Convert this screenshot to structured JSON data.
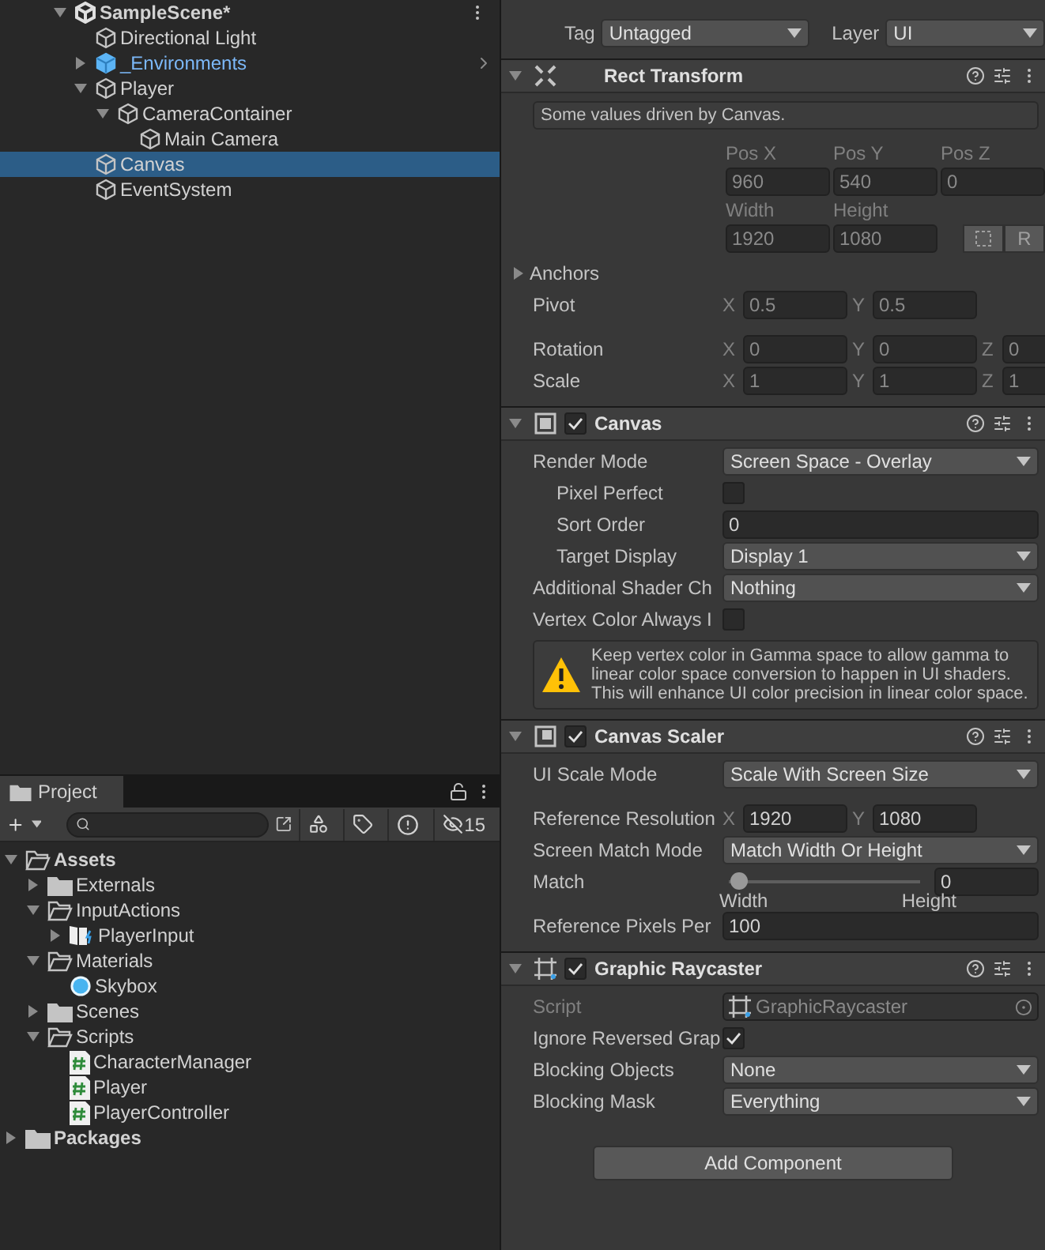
{
  "hierarchy": {
    "scene": "SampleScene*",
    "items": [
      {
        "name": "Directional Light",
        "kind": "object",
        "selected": false
      },
      {
        "name": "_Environments",
        "kind": "prefab",
        "expanded": false,
        "selected": false
      },
      {
        "name": "Player",
        "kind": "object",
        "expanded": true,
        "selected": false,
        "children": [
          {
            "name": "CameraContainer",
            "kind": "object",
            "expanded": true,
            "selected": false,
            "children": [
              {
                "name": "Main Camera",
                "kind": "object",
                "selected": false
              }
            ]
          }
        ]
      },
      {
        "name": "Canvas",
        "kind": "object",
        "selected": true
      },
      {
        "name": "EventSystem",
        "kind": "object",
        "selected": false
      }
    ]
  },
  "project": {
    "tab": "Project",
    "hidden_count": "15",
    "items": [
      {
        "name": "Assets",
        "kind": "folder",
        "expanded": true,
        "children": [
          {
            "name": "Externals",
            "kind": "folder",
            "expanded": false
          },
          {
            "name": "InputActions",
            "kind": "folder",
            "expanded": true,
            "children": [
              {
                "name": "PlayerInput",
                "kind": "input",
                "expanded": false
              }
            ]
          },
          {
            "name": "Materials",
            "kind": "folder",
            "expanded": true,
            "children": [
              {
                "name": "Skybox",
                "kind": "material"
              }
            ]
          },
          {
            "name": "Scenes",
            "kind": "folder",
            "expanded": false
          },
          {
            "name": "Scripts",
            "kind": "folder",
            "expanded": true,
            "children": [
              {
                "name": "CharacterManager",
                "kind": "script"
              },
              {
                "name": "Player",
                "kind": "script"
              },
              {
                "name": "PlayerController",
                "kind": "script"
              }
            ]
          }
        ]
      },
      {
        "name": "Packages",
        "kind": "folder",
        "expanded": false
      }
    ]
  },
  "inspector": {
    "tag_label": "Tag",
    "tag": "Untagged",
    "layer_label": "Layer",
    "layer": "UI",
    "components": [
      {
        "kind": "rect_transform",
        "title": "Rect Transform",
        "expanded": true,
        "note": "Some values driven by Canvas.",
        "position": [
          {
            "label": "Pos X",
            "value": "960"
          },
          {
            "label": "Pos Y",
            "value": "540"
          },
          {
            "label": "Pos Z",
            "value": "0"
          }
        ],
        "size": [
          {
            "label": "Width",
            "value": "1920"
          },
          {
            "label": "Height",
            "value": "1080"
          }
        ],
        "raw_button": "R",
        "anchors": "Anchors",
        "pivot": {
          "label": "Pivot",
          "axes": [
            {
              "axis": "X",
              "value": "0.5"
            },
            {
              "axis": "Y",
              "value": "0.5"
            }
          ]
        },
        "rotation": {
          "label": "Rotation",
          "axes": [
            {
              "axis": "X",
              "value": "0"
            },
            {
              "axis": "Y",
              "value": "0"
            },
            {
              "axis": "Z",
              "value": "0"
            }
          ]
        },
        "scale": {
          "label": "Scale",
          "axes": [
            {
              "axis": "X",
              "value": "1"
            },
            {
              "axis": "Y",
              "value": "1"
            },
            {
              "axis": "Z",
              "value": "1"
            }
          ]
        }
      },
      {
        "kind": "canvas",
        "title": "Canvas",
        "expanded": true,
        "enabled": true,
        "rows": [
          {
            "kind": "dropdown",
            "label": "Render Mode",
            "value": "Screen Space - Overlay",
            "children": [
              {
                "kind": "checkbox",
                "label": "Pixel Perfect",
                "checked": false
              },
              {
                "kind": "field",
                "label": "Sort Order",
                "value": "0"
              },
              {
                "kind": "dropdown",
                "label": "Target Display",
                "value": "Display 1"
              }
            ]
          },
          {
            "kind": "dropdown",
            "label": "Additional Shader Ch",
            "value": "Nothing"
          },
          {
            "kind": "checkbox",
            "label": "Vertex Color Always I",
            "checked": false
          },
          {
            "kind": "warning",
            "text": "Keep vertex color in Gamma space to allow gamma to linear color space conversion to happen in UI shaders. This will enhance UI color precision in linear color space."
          }
        ]
      },
      {
        "kind": "canvas_scaler",
        "title": "Canvas Scaler",
        "expanded": true,
        "enabled": true,
        "rows": [
          {
            "kind": "dropdown",
            "label": "UI Scale Mode",
            "value": "Scale With Screen Size"
          },
          {
            "kind": "vector",
            "label": "Reference Resolution",
            "axes": [
              {
                "axis": "X",
                "value": "1920"
              },
              {
                "axis": "Y",
                "value": "1080"
              }
            ]
          },
          {
            "kind": "dropdown",
            "label": "Screen Match Mode",
            "value": "Match Width Or Height"
          },
          {
            "kind": "slider",
            "label": "Match",
            "level": 0,
            "value": "0",
            "min_label": "Width",
            "max_label": "Height"
          },
          {
            "kind": "field",
            "label": "Reference Pixels Per",
            "value": "100"
          }
        ]
      },
      {
        "kind": "graphic_raycaster",
        "title": "Graphic Raycaster",
        "expanded": true,
        "enabled": true,
        "rows": [
          {
            "kind": "object",
            "label": "Script",
            "value": "GraphicRaycaster"
          },
          {
            "kind": "checkbox",
            "label": "Ignore Reversed Grap",
            "checked": true
          },
          {
            "kind": "dropdown",
            "label": "Blocking Objects",
            "value": "None"
          },
          {
            "kind": "dropdown",
            "label": "Blocking Mask",
            "value": "Everything"
          }
        ]
      }
    ],
    "add_component": "Add Component"
  }
}
